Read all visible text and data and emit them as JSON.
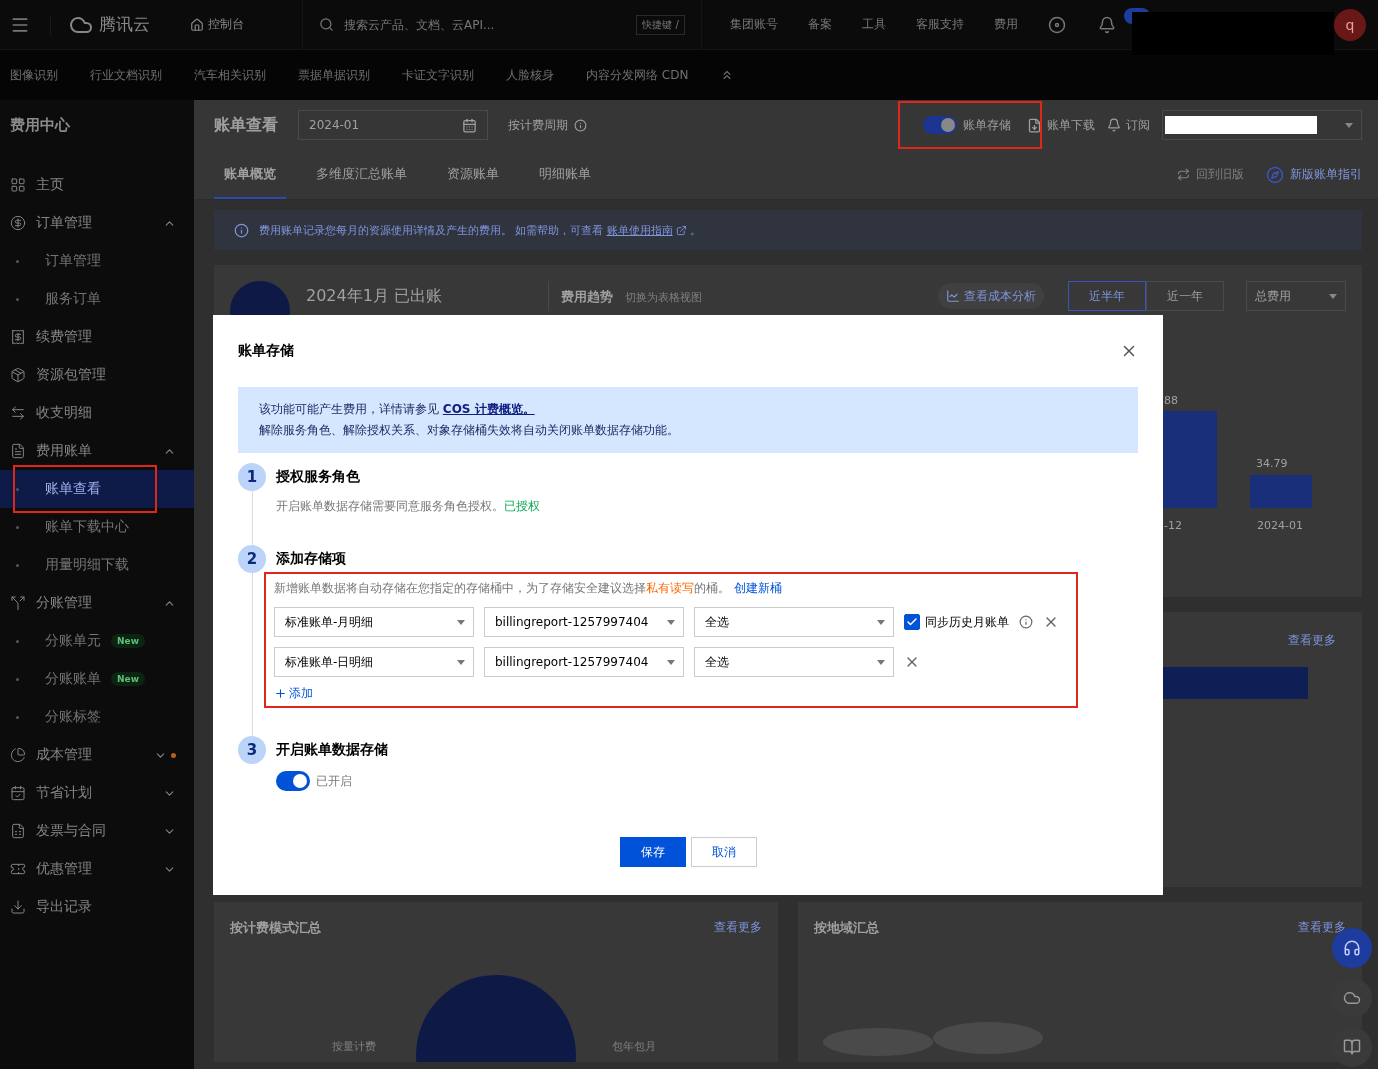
{
  "topbar": {
    "brand": "腾讯云",
    "console": "控制台",
    "search": {
      "placeholder": "搜索云产品、文档、云API...",
      "shortcut": "快捷键 /"
    },
    "nav": [
      "集团账号",
      "备案",
      "工具",
      "客服支持",
      "费用"
    ],
    "avatar": "q"
  },
  "subnav": {
    "items": [
      "图像识别",
      "行业文档识别",
      "汽车相关识别",
      "票据单据识别",
      "卡证文字识别",
      "人脸核身",
      "内容分发网络 CDN"
    ]
  },
  "sidebar": {
    "title": "费用中心",
    "items": [
      {
        "label": "主页",
        "selected": false
      },
      {
        "label": "订单管理",
        "selected": false,
        "expanded": true,
        "children": [
          {
            "label": "订单管理",
            "selected": false
          },
          {
            "label": "服务订单",
            "selected": false
          }
        ]
      },
      {
        "label": "续费管理",
        "selected": false
      },
      {
        "label": "资源包管理",
        "selected": false
      },
      {
        "label": "收支明细",
        "selected": false
      },
      {
        "label": "费用账单",
        "selected": false,
        "expanded": true,
        "children": [
          {
            "label": "账单查看",
            "selected": true
          },
          {
            "label": "账单下载中心",
            "selected": false
          },
          {
            "label": "用量明细下载",
            "selected": false
          }
        ]
      },
      {
        "label": "分账管理",
        "selected": false,
        "expanded": true,
        "children": [
          {
            "label": "分账单元",
            "selected": false,
            "badge": "New"
          },
          {
            "label": "分账账单",
            "selected": false,
            "badge": "New"
          },
          {
            "label": "分账标签",
            "selected": false
          }
        ]
      },
      {
        "label": "成本管理",
        "selected": false,
        "expanded": false,
        "notice": true
      },
      {
        "label": "节省计划",
        "selected": false,
        "expanded": false
      },
      {
        "label": "发票与合同",
        "selected": false,
        "expanded": false
      },
      {
        "label": "优惠管理",
        "selected": false,
        "expanded": false
      },
      {
        "label": "导出记录",
        "selected": false
      }
    ]
  },
  "header": {
    "title": "账单查看",
    "month": "2024-01",
    "cycle_label": "按计费周期",
    "storage_toggle": {
      "label": "账单存储",
      "on": true
    },
    "download": "账单下载",
    "subscribe": "订阅"
  },
  "tabs": [
    {
      "label": "账单概览",
      "selected": true
    },
    {
      "label": "多维度汇总账单",
      "selected": false
    },
    {
      "label": "资源账单",
      "selected": false
    },
    {
      "label": "明细账单",
      "selected": false
    }
  ],
  "tab_links": {
    "old_version": "回到旧版",
    "guide": "新版账单指引"
  },
  "banner": {
    "text": "费用账单记录您每月的资源使用详情及产生的费用。 如需帮助，可查看",
    "link": "账单使用指南",
    "tail": "。"
  },
  "summary": {
    "title": "2024年1月 已出账",
    "trend_title": "费用趋势",
    "trend_switch": "切换为表格视图",
    "cost_analysis": "查看成本分析",
    "ranges": [
      {
        "label": "近半年",
        "selected": true
      },
      {
        "label": "近一年",
        "selected": false
      }
    ],
    "metric": "总费用",
    "bar_labels": [
      "88",
      "34.79"
    ],
    "axis_labels": [
      "-12",
      "2024-01"
    ]
  },
  "detail_card": {
    "more": "查看更多"
  },
  "bottom_cards": [
    {
      "title": "按计费模式汇总",
      "more": "查看更多",
      "labels": [
        "按量计费",
        "包年包月"
      ]
    },
    {
      "title": "按地域汇总",
      "more": "查看更多"
    }
  ],
  "dialog": {
    "title": "账单存储",
    "notice": {
      "line1": "该功能可能产生费用，详情请参见 ",
      "link": "COS 计费概览。",
      "line2": "解除服务角色、解除授权关系、对象存储桶失效将自动关闭账单数据存储功能。"
    },
    "steps": [
      {
        "number": "1",
        "title": "授权服务角色",
        "desc": "开启账单数据存储需要同意服务角色授权。",
        "status": "已授权"
      },
      {
        "number": "2",
        "title": "添加存储项",
        "hint": "新增账单数据将自动存储在您指定的存储桶中，为了存储安全建议选择",
        "hint_emphasis": "私有读写",
        "hint_tail": "的桶。",
        "create_link": "创建新桶",
        "rows": [
          {
            "type": "标准账单-月明细",
            "bucket": "billingreport-1257997404",
            "scope": "全选",
            "sync": {
              "label": "同步历史月账单",
              "checked": true
            }
          },
          {
            "type": "标准账单-日明细",
            "bucket": "billingreport-1257997404",
            "scope": "全选"
          }
        ],
        "add": "添加"
      },
      {
        "number": "3",
        "title": "开启账单数据存储",
        "switch": {
          "on": true,
          "label": "已开启"
        }
      }
    ],
    "buttons": {
      "save": "保存",
      "cancel": "取消"
    }
  }
}
